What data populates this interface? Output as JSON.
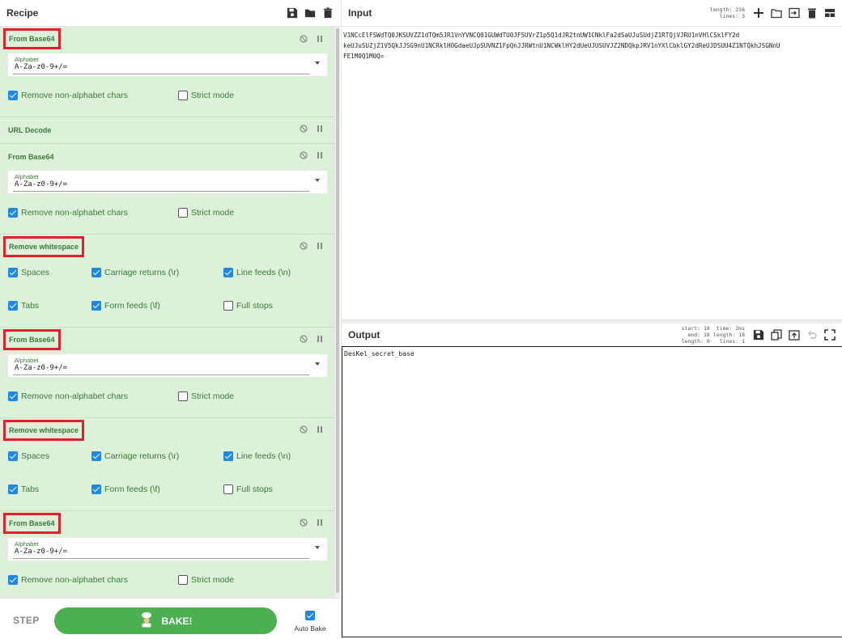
{
  "recipe": {
    "title": "Recipe",
    "operations": [
      {
        "title": "From Base64",
        "alphabet_label": "Alphabet",
        "alphabet_value": "A-Za-z0-9+/=",
        "opt1": "Remove non-alphabet chars",
        "opt2": "Strict mode"
      },
      {
        "title": "URL Decode"
      },
      {
        "title": "From Base64",
        "alphabet_label": "Alphabet",
        "alphabet_value": "A-Za-z0-9+/=",
        "opt1": "Remove non-alphabet chars",
        "opt2": "Strict mode"
      },
      {
        "title": "Remove whitespace",
        "spaces": "Spaces",
        "cr": "Carriage returns (\\r)",
        "lf": "Line feeds (\\n)",
        "tabs": "Tabs",
        "ff": "Form feeds (\\f)",
        "stops": "Full stops"
      },
      {
        "title": "From Base64",
        "alphabet_label": "Alphabet",
        "alphabet_value": "A-Za-z0-9+/=",
        "opt1": "Remove non-alphabet chars",
        "opt2": "Strict mode"
      },
      {
        "title": "Remove whitespace",
        "spaces": "Spaces",
        "cr": "Carriage returns (\\r)",
        "lf": "Line feeds (\\n)",
        "tabs": "Tabs",
        "ff": "Form feeds (\\f)",
        "stops": "Full stops"
      },
      {
        "title": "From Base64",
        "alphabet_label": "Alphabet",
        "alphabet_value": "A-Za-z0-9+/=",
        "opt1": "Remove non-alphabet chars",
        "opt2": "Strict mode"
      }
    ]
  },
  "controls": {
    "step_label": "STEP",
    "bake_label": "BAKE!",
    "autobake_label": "Auto Bake"
  },
  "input": {
    "title": "Input",
    "length_label": "length:",
    "length_value": "238",
    "lines_label": "lines:",
    "lines_value": "3",
    "text_line1": "V1NCcElFSWdTQ0JKSUVZZ1dTQm5JR1VnYVNCQ01GUWdTU0JFSUVrZ1p5Q1dJR2tnUW1CNklFa2dSaUJuSUdjZ1RTQjVJRU1nVHlCSklFY2d",
    "text_line2": "keUJuSUZjZ1V5QkJJSG9nU1NCRklHOGdaeUJpSUVNZ1FpQnJJRWtnU1NCWklHY2dUeUJUSUVJZ2NDQkpJRV1nYXlCbklGY2dReUJDSUU4Z1NTQkhJSGNnU",
    "text_line3": "FE1M0Q1M0Q="
  },
  "output": {
    "title": "Output",
    "start_label": "start:",
    "start_value": "18",
    "end_label": "end:",
    "end_value": "18",
    "olength_label": "length:",
    "olength_value": "0",
    "time_label": "time:",
    "time_value": "2ms",
    "length_label": "length:",
    "length_value": "18",
    "lines_label": "lines:",
    "lines_value": "1",
    "text": "DesKel_secret_base"
  },
  "colors": {
    "op_background": "#dcf0da",
    "op_title": "#3b7a39",
    "highlight_box": "#e0202a",
    "checkbox_on": "#1e88e5",
    "bake_button": "#4cb050"
  }
}
